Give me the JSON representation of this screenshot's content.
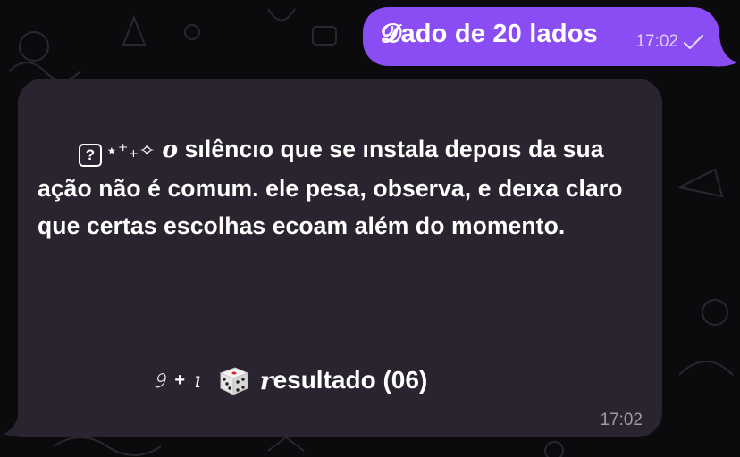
{
  "outgoing": {
    "text": "𝓓ado de 20 lados",
    "time": "17:02",
    "status_icon": "single-check-icon"
  },
  "incoming": {
    "sparkles": "⋆⁺₊✧",
    "first_word": "𝒐",
    "body": "sılêncıo que se ınstala depoıs da sua ação não é comum. ele pesa, observa, e deıxa claro que certas escolhas ecoam além do momento.",
    "result_deco": "𝟿",
    "result_deco2": "ı",
    "result_plus": "+",
    "result_icon": "dice-icon",
    "result_r": "𝒓",
    "result_text": "esultado (06)",
    "time": "17:02"
  },
  "colors": {
    "background": "#0b0a0d",
    "outgoing_bubble": "#8a4cf3",
    "incoming_bubble": "#2a2430"
  }
}
